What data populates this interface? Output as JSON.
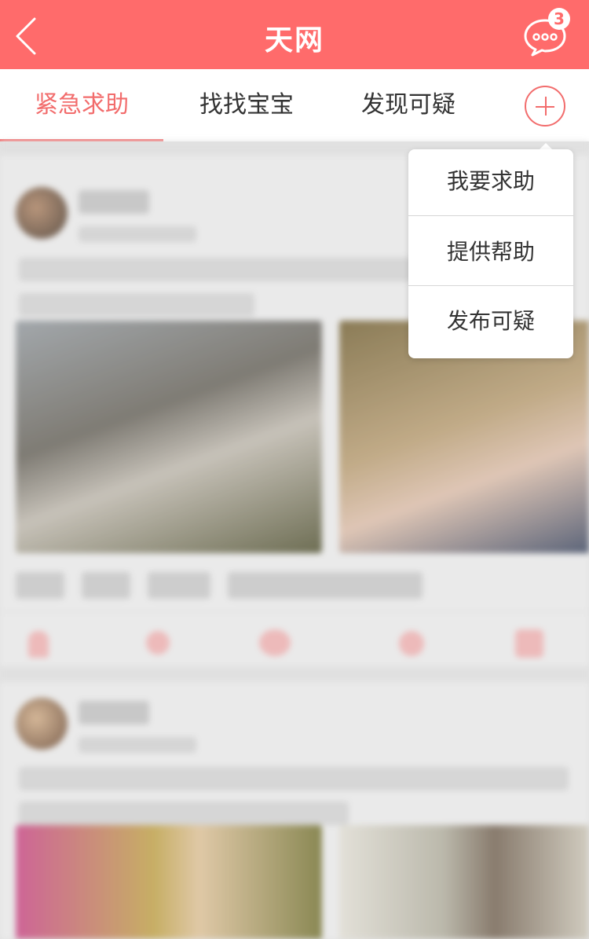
{
  "header": {
    "title": "天网",
    "message_count": "3",
    "icons": {
      "back": "chevron-left-icon",
      "messages": "chat-bubble-icon"
    }
  },
  "tabs": [
    {
      "label": "紧急求助",
      "active": true
    },
    {
      "label": "找找宝宝",
      "active": false
    },
    {
      "label": "发现可疑",
      "active": false
    }
  ],
  "add_button": {
    "icon": "plus-circle-icon"
  },
  "dropdown": {
    "items": [
      {
        "label": "我要求助"
      },
      {
        "label": "提供帮助"
      },
      {
        "label": "发布可疑"
      }
    ]
  },
  "colors": {
    "brand": "#ff6b6b",
    "accent": "#f26c6c",
    "text": "#333333"
  }
}
